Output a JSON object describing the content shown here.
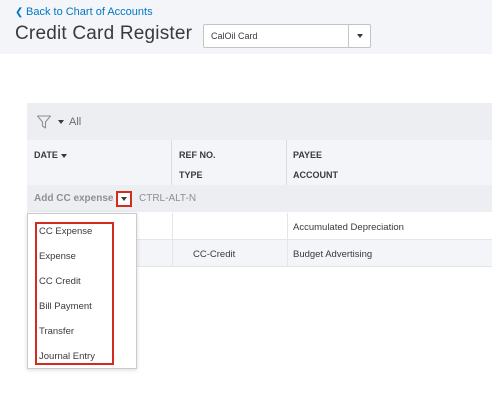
{
  "header": {
    "back_link": "Back to Chart of Accounts",
    "title": "Credit Card Register",
    "account_select": {
      "value": "CalOil Card"
    }
  },
  "filter": {
    "label": "All"
  },
  "columns": {
    "date": "DATE",
    "ref_no": "REF NO.",
    "type": "TYPE",
    "payee": "PAYEE",
    "account": "ACCOUNT"
  },
  "add_row": {
    "label": "Add CC expense",
    "shortcut": "CTRL-ALT-N"
  },
  "rows": [
    {
      "type": "",
      "account": "Accumulated Depreciation"
    },
    {
      "type": "CC-Credit",
      "account": "Budget Advertising"
    }
  ],
  "dropdown": {
    "items": [
      "CC Expense",
      "Expense",
      "CC Credit",
      "Bill Payment",
      "Transfer",
      "Journal Entry"
    ]
  },
  "colors": {
    "link": "#0077c5",
    "highlight": "#d52b1e",
    "header_bg": "#f4f5f8"
  },
  "icons": {
    "back": "chevron-left-icon",
    "account_arrow": "caret-down-icon",
    "filter": "funnel-icon",
    "add_toggle": "caret-down-icon"
  }
}
